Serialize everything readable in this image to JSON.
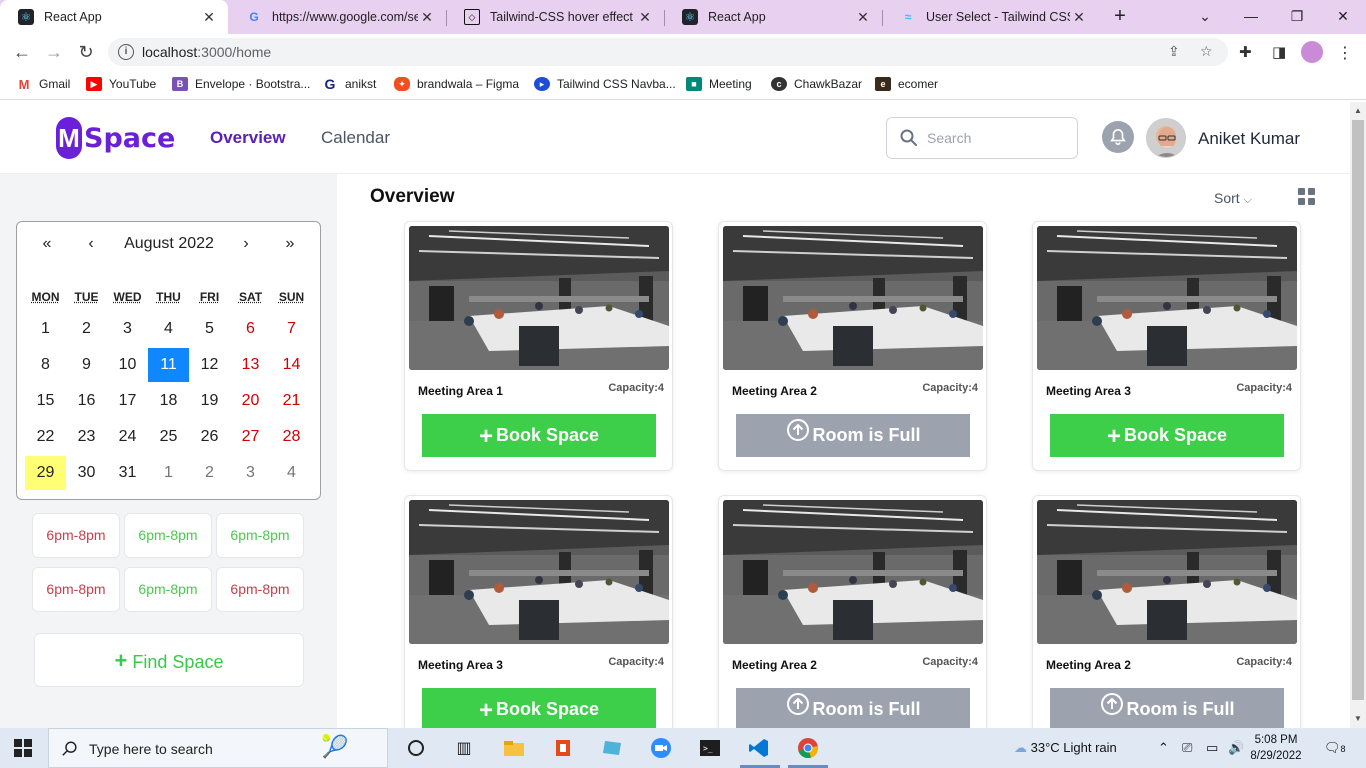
{
  "browser": {
    "tabs": [
      {
        "title": "React App",
        "active": true
      },
      {
        "title": "https://www.google.com/sea",
        "active": false
      },
      {
        "title": "Tailwind-CSS hover effect wit",
        "active": false
      },
      {
        "title": "React App",
        "active": false
      },
      {
        "title": "User Select - Tailwind CSS",
        "active": false
      }
    ],
    "url_host": "localhost",
    "url_rest": ":3000/home",
    "bookmarks": [
      {
        "label": "Gmail",
        "icon": "gmail-icon"
      },
      {
        "label": "YouTube",
        "icon": "youtube-icon"
      },
      {
        "label": "Envelope · Bootstra...",
        "icon": "bootstrap-icon"
      },
      {
        "label": "anikst",
        "icon": "g-logo-icon"
      },
      {
        "label": "brandwala – Figma",
        "icon": "figma-icon"
      },
      {
        "label": "Tailwind CSS Navba...",
        "icon": "tailwind-icon"
      },
      {
        "label": "Meeting",
        "icon": "meet-icon"
      },
      {
        "label": "ChawkBazar",
        "icon": "chawkbazar-icon"
      },
      {
        "label": "ecomer",
        "icon": "ecomer-icon"
      }
    ]
  },
  "app": {
    "logo_letter": "M",
    "logo_text": "Space",
    "nav": [
      {
        "label": "Overview",
        "active": true
      },
      {
        "label": "Calendar",
        "active": false
      }
    ],
    "search_placeholder": "Search",
    "user_name": "Aniket Kumar"
  },
  "calendar": {
    "nav_prev_year": "«",
    "nav_prev_month": "‹",
    "month_label": "August 2022",
    "nav_next_month": "›",
    "nav_next_year": "»",
    "weekdays": [
      "MON",
      "TUE",
      "WED",
      "THU",
      "FRI",
      "SAT",
      "SUN"
    ],
    "weeks": [
      [
        "1",
        "2",
        "3",
        "4",
        "5",
        "6",
        "7"
      ],
      [
        "8",
        "9",
        "10",
        "11",
        "12",
        "13",
        "14"
      ],
      [
        "15",
        "16",
        "17",
        "18",
        "19",
        "20",
        "21"
      ],
      [
        "22",
        "23",
        "24",
        "25",
        "26",
        "27",
        "28"
      ],
      [
        "29",
        "30",
        "31",
        "1",
        "2",
        "3",
        "4"
      ]
    ],
    "selected_day": "11",
    "today_day": "29"
  },
  "time_slots": [
    {
      "label": "6pm-8pm",
      "status": "red"
    },
    {
      "label": "6pm-8pm",
      "status": "green"
    },
    {
      "label": "6pm-8pm",
      "status": "green"
    },
    {
      "label": "6pm-8pm",
      "status": "red"
    },
    {
      "label": "6pm-8pm",
      "status": "green"
    },
    {
      "label": "6pm-8pm",
      "status": "red"
    }
  ],
  "find_space_label": "Find Space",
  "overview": {
    "title": "Overview",
    "sort_label": "Sort",
    "cards": [
      {
        "name": "Meeting Area 1",
        "capacity": "Capacity:4",
        "button": "Book Space",
        "state": "book"
      },
      {
        "name": "Meeting Area 2",
        "capacity": "Capacity:4",
        "button": "Room is Full",
        "state": "full"
      },
      {
        "name": "Meeting Area 3",
        "capacity": "Capacity:4",
        "button": "Book Space",
        "state": "book"
      },
      {
        "name": "Meeting Area 3",
        "capacity": "Capacity:4",
        "button": "Book Space",
        "state": "book"
      },
      {
        "name": "Meeting Area 2",
        "capacity": "Capacity:4",
        "button": "Room is Full",
        "state": "full"
      },
      {
        "name": "Meeting Area 2",
        "capacity": "Capacity:4",
        "button": "Room is Full",
        "state": "full"
      }
    ]
  },
  "colors": {
    "brand": "#6a1fd8",
    "book": "#3ecf4a",
    "full": "#9ca3af",
    "slot_red": "#c2414b",
    "slot_green": "#4ac94f",
    "calendar_selected": "#1087ff",
    "calendar_today": "#ffff76"
  },
  "taskbar": {
    "search_text": "Type here to search",
    "weather": "33°C  Light rain",
    "time": "5:08 PM",
    "date": "8/29/2022",
    "notification_count": "8"
  }
}
